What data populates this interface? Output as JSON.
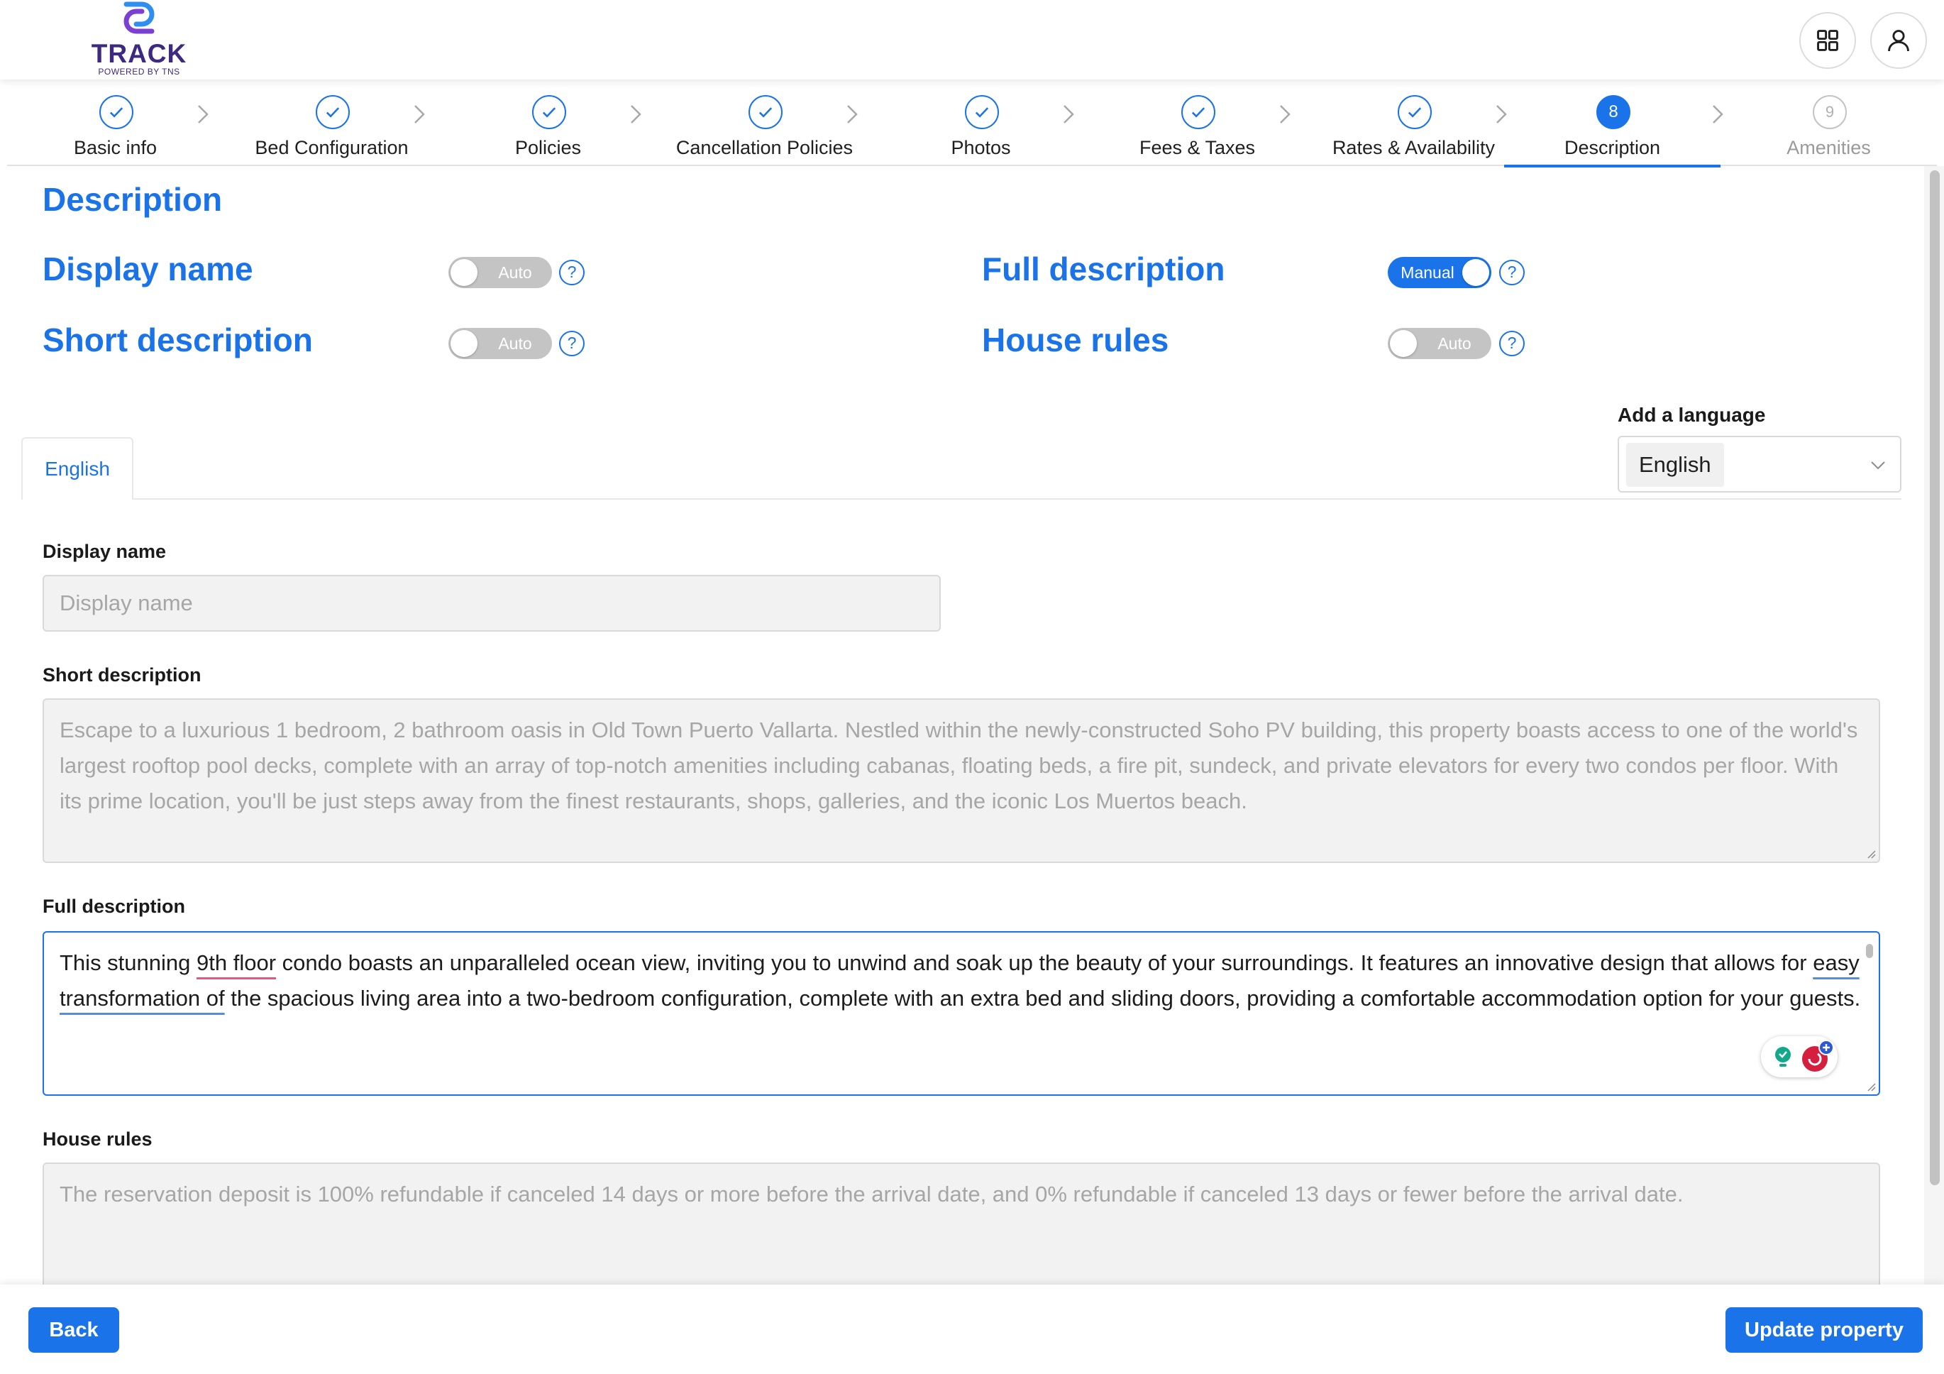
{
  "header": {
    "logo_text": "TRACK",
    "logo_subtext": "POWERED BY TNS",
    "apps_icon": "grid-icon",
    "user_icon": "user-icon"
  },
  "stepper": {
    "steps": [
      {
        "number": "1",
        "label": "Basic info",
        "state": "completed"
      },
      {
        "number": "2",
        "label": "Bed Configuration",
        "state": "completed"
      },
      {
        "number": "3",
        "label": "Policies",
        "state": "completed"
      },
      {
        "number": "4",
        "label": "Cancellation Policies",
        "state": "completed"
      },
      {
        "number": "5",
        "label": "Photos",
        "state": "completed"
      },
      {
        "number": "6",
        "label": "Fees & Taxes",
        "state": "completed"
      },
      {
        "number": "7",
        "label": "Rates & Availability",
        "state": "completed"
      },
      {
        "number": "8",
        "label": "Description",
        "state": "active"
      },
      {
        "number": "9",
        "label": "Amenities",
        "state": "pending"
      }
    ]
  },
  "description": {
    "title": "Description",
    "toggles": {
      "display_name": {
        "label": "Display name",
        "mode": "Auto",
        "on": false
      },
      "full_description": {
        "label": "Full description",
        "mode": "Manual",
        "on": true
      },
      "short_description": {
        "label": "Short description",
        "mode": "Auto",
        "on": false
      },
      "house_rules": {
        "label": "House rules",
        "mode": "Auto",
        "on": false
      }
    },
    "help_glyph": "?"
  },
  "language": {
    "add_label": "Add a language",
    "selected": "English",
    "tabs": [
      "English"
    ]
  },
  "fields": {
    "display_name": {
      "label": "Display name",
      "placeholder": "Display name",
      "value": ""
    },
    "short_description": {
      "label": "Short description",
      "value": "Escape to a luxurious 1 bedroom, 2 bathroom oasis in Old Town Puerto Vallarta. Nestled within the newly-constructed Soho PV building, this property boasts access to one of the world's largest rooftop pool decks, complete with an array of top-notch amenities including cabanas, floating beds, a fire pit, sundeck, and private elevators for every two condos per floor. With its prime location, you'll be just steps away from the finest restaurants, shops, galleries, and the iconic Los Muertos beach."
    },
    "full_description": {
      "label": "Full description",
      "segments": {
        "s1": "This stunning ",
        "s2": "9th floor",
        "s3": " condo boasts an unparalleled ocean view, inviting you to unwind and soak up the beauty of your surroundings. It features an innovative design that allows for ",
        "s4": "easy transformation of",
        "s5": " the spacious living area into a two-bedroom configuration, complete with an extra bed and sliding doors, providing a comfortable accommodation option for your guests."
      }
    },
    "house_rules": {
      "label": "House rules",
      "value": "The reservation deposit is 100% refundable if canceled 14 days or more before the arrival date, and 0% refundable if canceled 13 days or fewer before the arrival date."
    }
  },
  "footer": {
    "back_label": "Back",
    "update_label": "Update property"
  },
  "colors": {
    "accent": "#1a73e8",
    "logo": "#3d2a80",
    "toggle_off": "#c4c4c4",
    "field_bg": "#f2f2f2"
  }
}
